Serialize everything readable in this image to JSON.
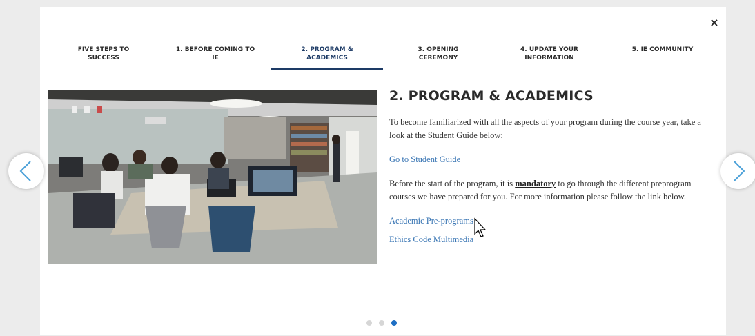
{
  "modal": {
    "close_label": "×",
    "tabs": [
      {
        "line1": "FIVE STEPS TO",
        "line2": "SUCCESS"
      },
      {
        "line1": "1. BEFORE COMING TO",
        "line2": "IE"
      },
      {
        "line1": "2. PROGRAM &",
        "line2": "ACADEMICS"
      },
      {
        "line1": "3. OPENING",
        "line2": "CEREMONY"
      },
      {
        "line1": "4. UPDATE YOUR",
        "line2": "INFORMATION"
      },
      {
        "line1": "5. IE COMMUNITY",
        "line2": ""
      }
    ],
    "active_tab_index": 2,
    "content": {
      "heading": "2. PROGRAM & ACADEMICS",
      "intro": "To become familiarized with all the aspects of your program during the course year, take a look at the Student Guide below:",
      "link_student_guide": "Go to Student Guide",
      "para2_before": "Before the start of the program, it is ",
      "para2_emphasis": "mandatory",
      "para2_after": " to go through the different preprogram courses we have prepared for you. For more information please follow the link below.",
      "link_preprograms": "Academic Pre-programs",
      "link_ethics": "Ethics Code Multimedia"
    },
    "pagination": {
      "total": 3,
      "active": 3
    }
  },
  "colors": {
    "accent": "#1d3b66",
    "link": "#3a76b4",
    "arrow": "#4aa0d8",
    "dot_active": "#1f6fc4"
  },
  "icons": {
    "prev": "chevron-left-icon",
    "next": "chevron-right-icon",
    "close": "close-icon",
    "cursor": "mouse-pointer-icon"
  }
}
